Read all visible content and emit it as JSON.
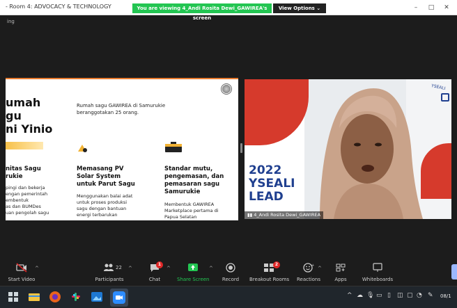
{
  "window": {
    "title": "- Room 4: ADVOCACY & TECHNOLOGY",
    "viewing_banner": "You are viewing 4_Andi Rosita Dewi_GAWIREA's screen",
    "view_options": "View Options",
    "recording_label": "ing"
  },
  "slide": {
    "heading_lines": [
      "umah",
      "gu",
      "ni Yinio"
    ],
    "intro_lines": [
      "Rumah sagu GAWIREA di Samurukie",
      "beranggotakan 25 orang."
    ],
    "col1": {
      "title_lines": [
        "nitas Sagu",
        "rukie"
      ],
      "body_lines": [
        "pingi dan bekerja",
        "engan pemerintah",
        "embentuk",
        "as dan BUMDes",
        "uan pengolah sagu"
      ]
    },
    "col2": {
      "title_lines": [
        "Memasang PV",
        "Solar System",
        "untuk Parut Sagu"
      ],
      "body_lines": [
        "Menggunakan balai adat",
        "untuk proses produksi",
        "sagu dengan bantuan",
        "energi terbarukan"
      ]
    },
    "col3": {
      "title_lines": [
        "Standar mutu,",
        "pengemasan, dan",
        "pemasaran sagu",
        "Samurukie"
      ],
      "body_lines": [
        "Membentuk GAWIREA",
        "Marketplace pertama di",
        "Papua Selatan"
      ]
    }
  },
  "video": {
    "brand_2022": "2022",
    "brand_yseali": "YSEALI",
    "brand_lead": "LEAD",
    "brand_small": "YSEALI",
    "participant_name": "4_Andi Rosita Dewi_GAWIREA"
  },
  "toolbar": {
    "start_video": "Start Video",
    "participants": "Participants",
    "participants_count": "22",
    "chat": "Chat",
    "chat_badge": "1",
    "share_screen": "Share Screen",
    "record": "Record",
    "breakout_rooms": "Breakout Rooms",
    "breakout_badge": "2",
    "reactions": "Reactions",
    "apps": "Apps",
    "whiteboards": "Whiteboards"
  },
  "taskbar": {
    "clock": "08/1"
  },
  "colors": {
    "share_green": "#23c552",
    "badge_red": "#e02828",
    "slide_accent": "#e87c2f",
    "brand_blue": "#1f3f8f"
  },
  "icons": [
    "minimize-icon",
    "maximize-icon",
    "close-icon",
    "video-off-icon",
    "participants-icon",
    "chat-icon",
    "share-screen-icon",
    "record-icon",
    "breakout-rooms-icon",
    "reactions-icon",
    "apps-icon",
    "whiteboards-icon"
  ]
}
